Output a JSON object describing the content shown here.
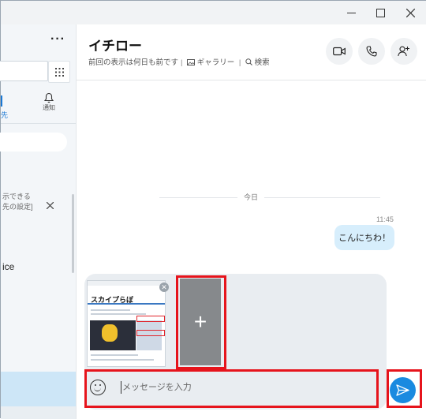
{
  "window": {
    "controls": [
      "minimize",
      "maximize",
      "close"
    ]
  },
  "sidebar": {
    "more_label": "···",
    "nav": {
      "contacts_label_fragment": "先",
      "notifications_label": "通知"
    },
    "notice": {
      "line1": "示できる",
      "line2": "先の設定]"
    },
    "contact_name_fragment": "ice"
  },
  "chat": {
    "title": "イチロー",
    "last_seen": "前回の表示は何日も前です",
    "gallery_label": "ギャラリー",
    "search_label": "検索",
    "separator": "|",
    "date_divider": "今日",
    "messages": [
      {
        "time": "11:45",
        "text": "こんにちわ！",
        "outgoing": true
      }
    ]
  },
  "composer": {
    "attachment": {
      "preview_title": "スカイプらぼ"
    },
    "add_file_label": "+",
    "input_placeholder": "メッセージを入力",
    "input_value": ""
  },
  "colors": {
    "accent": "#1a8ae0",
    "highlight_frame": "#e6141c",
    "outgoing_bubble": "#d7eefc"
  }
}
